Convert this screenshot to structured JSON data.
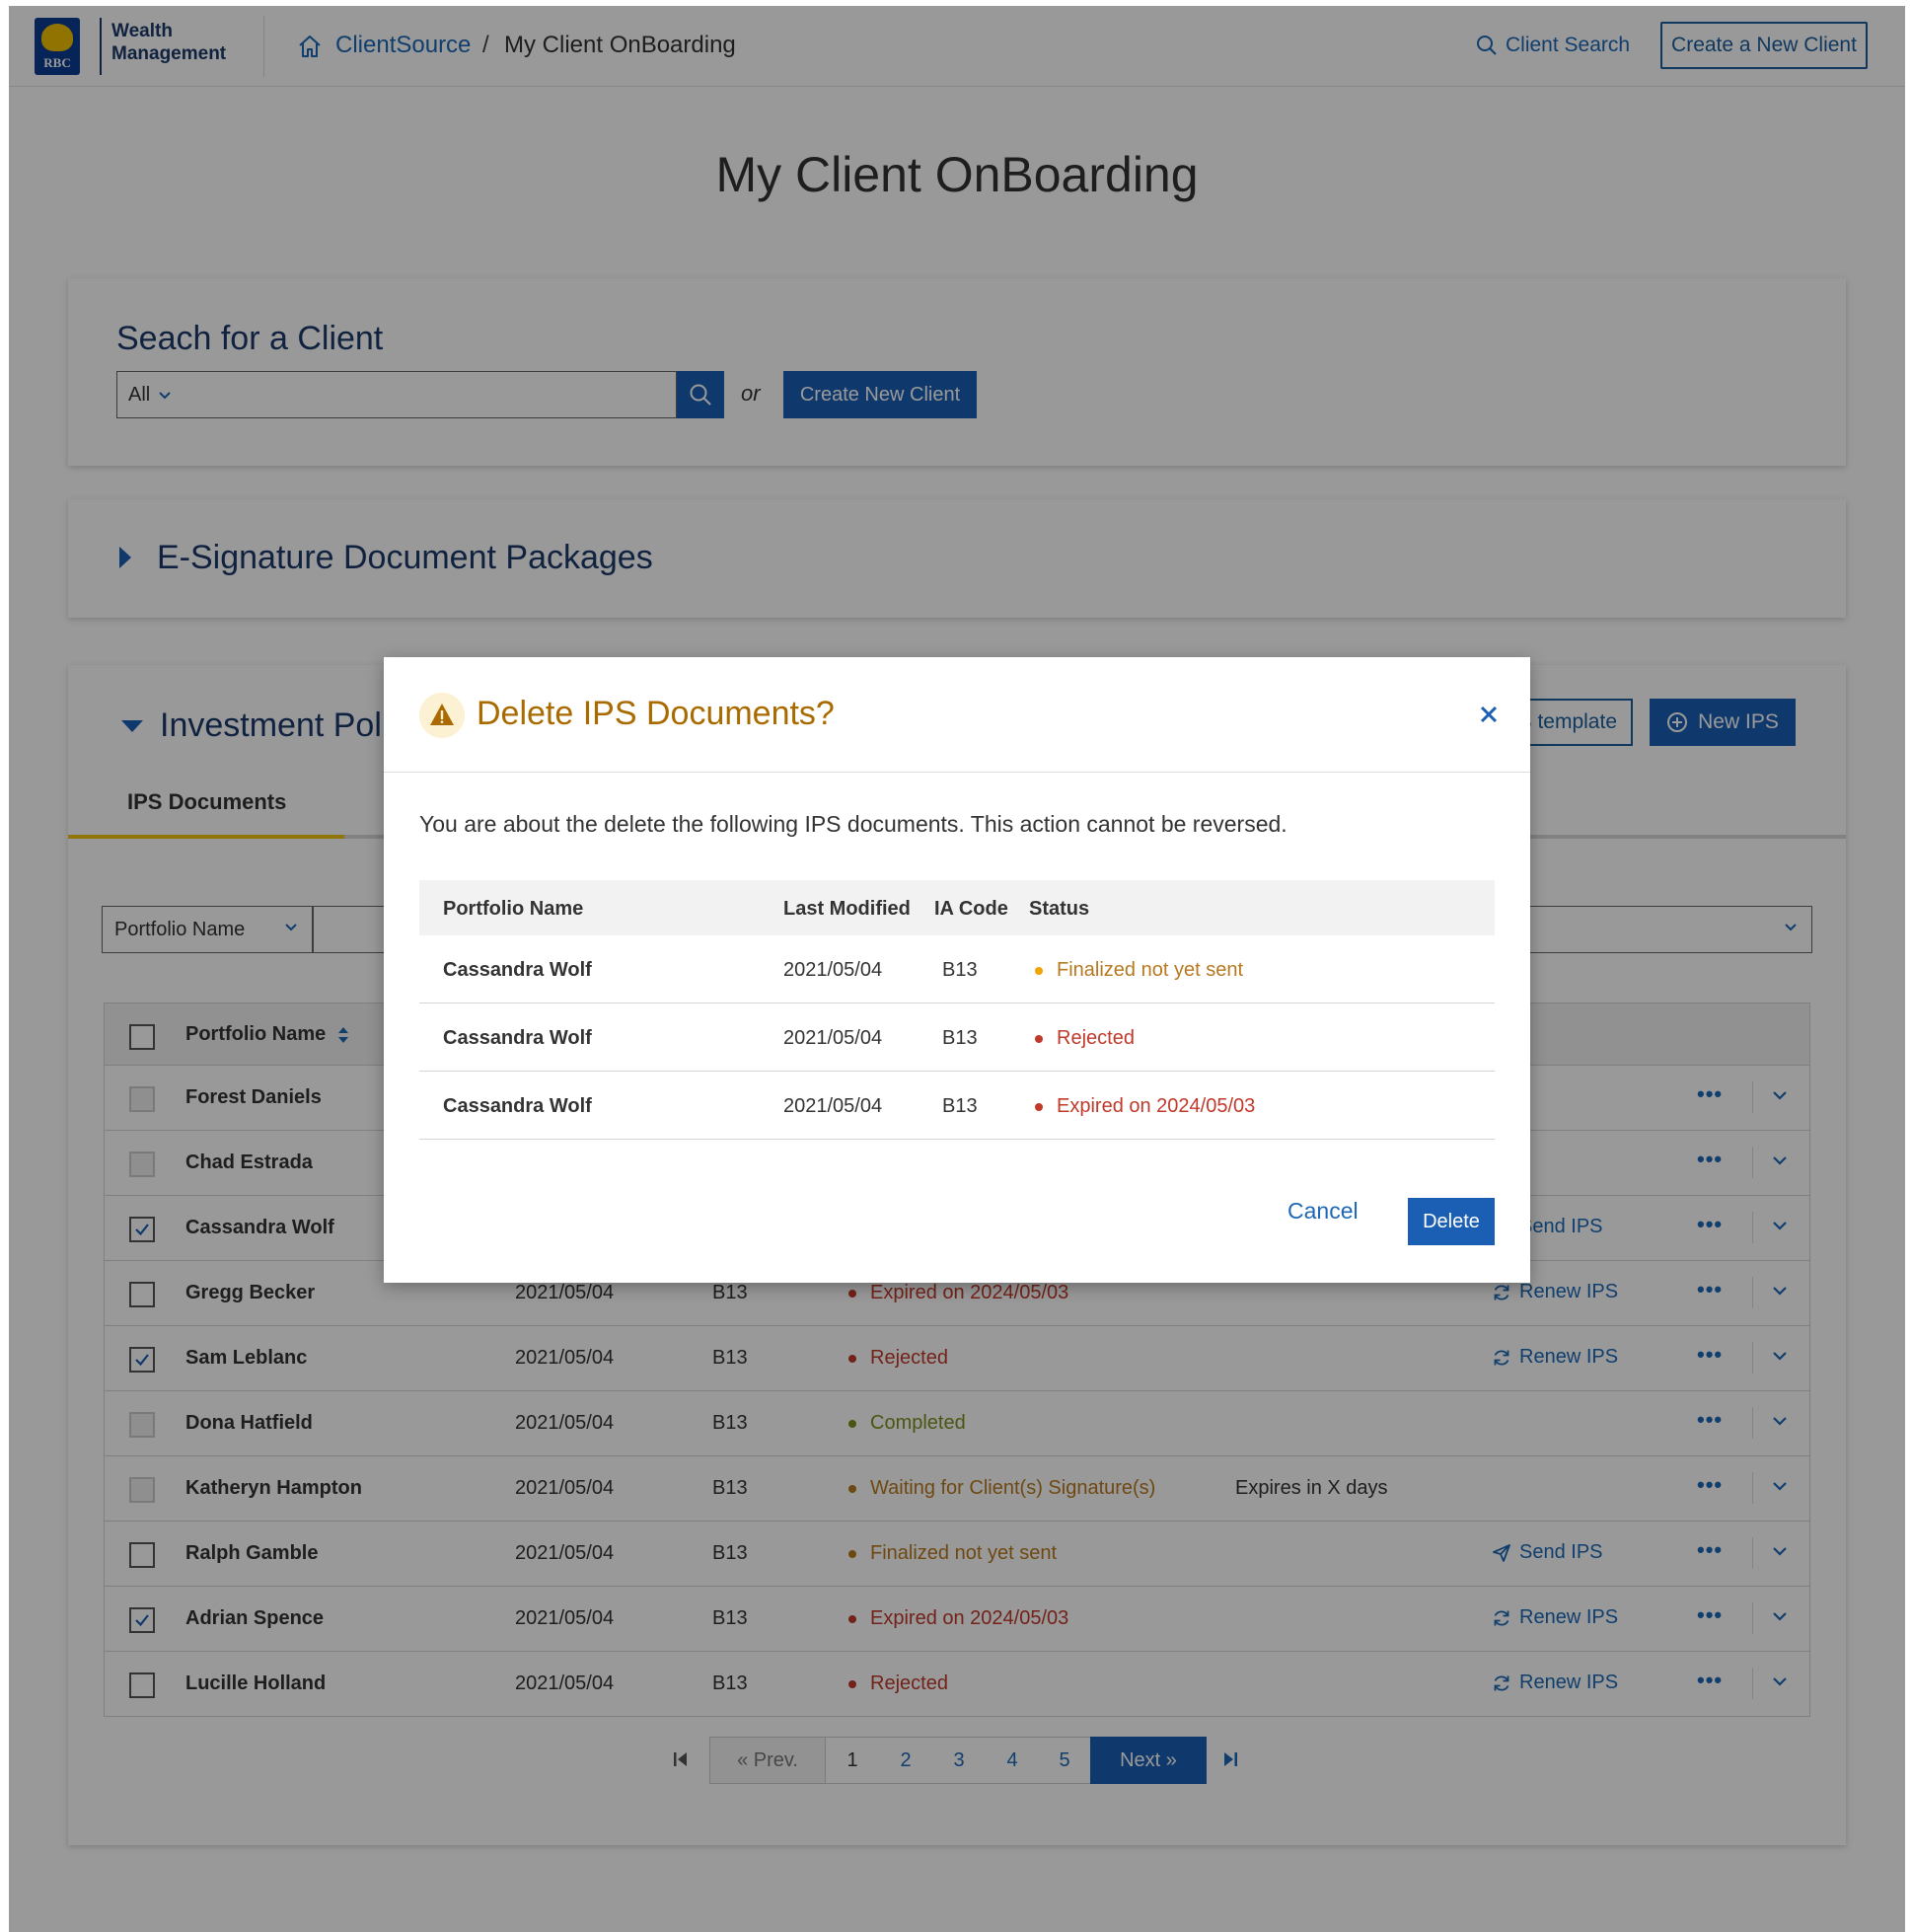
{
  "header": {
    "brand_line1": "Wealth",
    "brand_line2": "Management",
    "logo_text": "RBC",
    "breadcrumb_link": "ClientSource",
    "breadcrumb_sep": "/",
    "breadcrumb_current": "My Client OnBoarding",
    "search_label": "Client Search",
    "create_label": "Create a New Client"
  },
  "page": {
    "title": "My Client OnBoarding"
  },
  "search_card": {
    "heading": "Seach for a Client",
    "scope": "All",
    "or": "or",
    "create_label": "Create New Client"
  },
  "esig_card": {
    "title": "E-Signature Document Packages"
  },
  "ips_card": {
    "title": "Investment Pol",
    "template_label": "S template",
    "new_label": "New IPS",
    "tab_label": "IPS Documents",
    "filter_label": "Portfolio Name",
    "table_header": {
      "name": "Portfolio Name"
    },
    "rows": [
      {
        "name": "Forest Daniels",
        "date": "",
        "ia": "",
        "status": "",
        "status_color": "",
        "note": "",
        "action": "",
        "checkbox": "disabled"
      },
      {
        "name": "Chad Estrada",
        "date": "",
        "ia": "",
        "status": "",
        "status_color": "",
        "note": "",
        "action": "",
        "checkbox": "disabled"
      },
      {
        "name": "Cassandra Wolf",
        "date": "",
        "ia": "",
        "status": "",
        "status_color": "",
        "note": "",
        "action": "Send IPS",
        "checkbox": "checked"
      },
      {
        "name": "Gregg Becker",
        "date": "2021/05/04",
        "ia": "B13",
        "status": "Expired on 2024/05/03",
        "status_color": "#c0392b",
        "note": "",
        "action": "Renew IPS",
        "checkbox": "unchecked"
      },
      {
        "name": "Sam Leblanc",
        "date": "2021/05/04",
        "ia": "B13",
        "status": "Rejected",
        "status_color": "#c0392b",
        "note": "",
        "action": "Renew IPS",
        "checkbox": "checked"
      },
      {
        "name": "Dona Hatfield",
        "date": "2021/05/04",
        "ia": "B13",
        "status": "Completed",
        "status_color": "#7a8f1f",
        "note": "",
        "action": "",
        "checkbox": "disabled"
      },
      {
        "name": "Katheryn Hampton",
        "date": "2021/05/04",
        "ia": "B13",
        "status": "Waiting for Client(s) Signature(s)",
        "status_color": "#b7791f",
        "note": "Expires in X days",
        "action": "",
        "checkbox": "disabled"
      },
      {
        "name": "Ralph Gamble",
        "date": "2021/05/04",
        "ia": "B13",
        "status": "Finalized not yet sent",
        "status_color": "#b7791f",
        "note": "",
        "action": "Send IPS",
        "checkbox": "unchecked"
      },
      {
        "name": "Adrian Spence",
        "date": "2021/05/04",
        "ia": "B13",
        "status": "Expired on 2024/05/03",
        "status_color": "#c0392b",
        "note": "",
        "action": "Renew IPS",
        "checkbox": "checked"
      },
      {
        "name": "Lucille Holland",
        "date": "2021/05/04",
        "ia": "B13",
        "status": "Rejected",
        "status_color": "#c0392b",
        "note": "",
        "action": "Renew IPS",
        "checkbox": "unchecked"
      }
    ],
    "more_label": "•••",
    "pagination": {
      "prev": "« Prev.",
      "pages": [
        "1",
        "2",
        "3",
        "4",
        "5"
      ],
      "next": "Next »"
    }
  },
  "modal": {
    "title": "Delete IPS Documents?",
    "message": "You are about the delete the following IPS documents. This action cannot be reversed.",
    "columns": {
      "name": "Portfolio Name",
      "modified": "Last Modified",
      "ia": "IA Code",
      "status": "Status"
    },
    "rows": [
      {
        "name": "Cassandra Wolf",
        "date": "2021/05/04",
        "ia": "B13",
        "status": "Finalized not yet sent",
        "status_color": "#b7791f",
        "dot_color": "#f0a500"
      },
      {
        "name": "Cassandra Wolf",
        "date": "2021/05/04",
        "ia": "B13",
        "status": "Rejected",
        "status_color": "#c0392b",
        "dot_color": "#c0392b"
      },
      {
        "name": "Cassandra Wolf",
        "date": "2021/05/04",
        "ia": "B13",
        "status": "Expired on 2024/05/03",
        "status_color": "#c0392b",
        "dot_color": "#c0392b"
      }
    ],
    "cancel_label": "Cancel",
    "delete_label": "Delete"
  },
  "colors": {
    "primary": "#1a5fb4",
    "link": "#1c68b6",
    "navy": "#1b3a6b",
    "warning": "#a96a00",
    "error": "#c0392b",
    "success": "#7a8f1f",
    "tab_accent": "#f1c40f"
  },
  "icons": [
    "home-icon",
    "search-icon",
    "chevron-down-icon",
    "caret-right-icon",
    "caret-down-icon",
    "plus-circle-icon",
    "sort-icon",
    "check-icon",
    "send-icon",
    "refresh-icon",
    "more-icon",
    "first-page-icon",
    "last-page-icon",
    "warning-icon",
    "close-icon"
  ]
}
